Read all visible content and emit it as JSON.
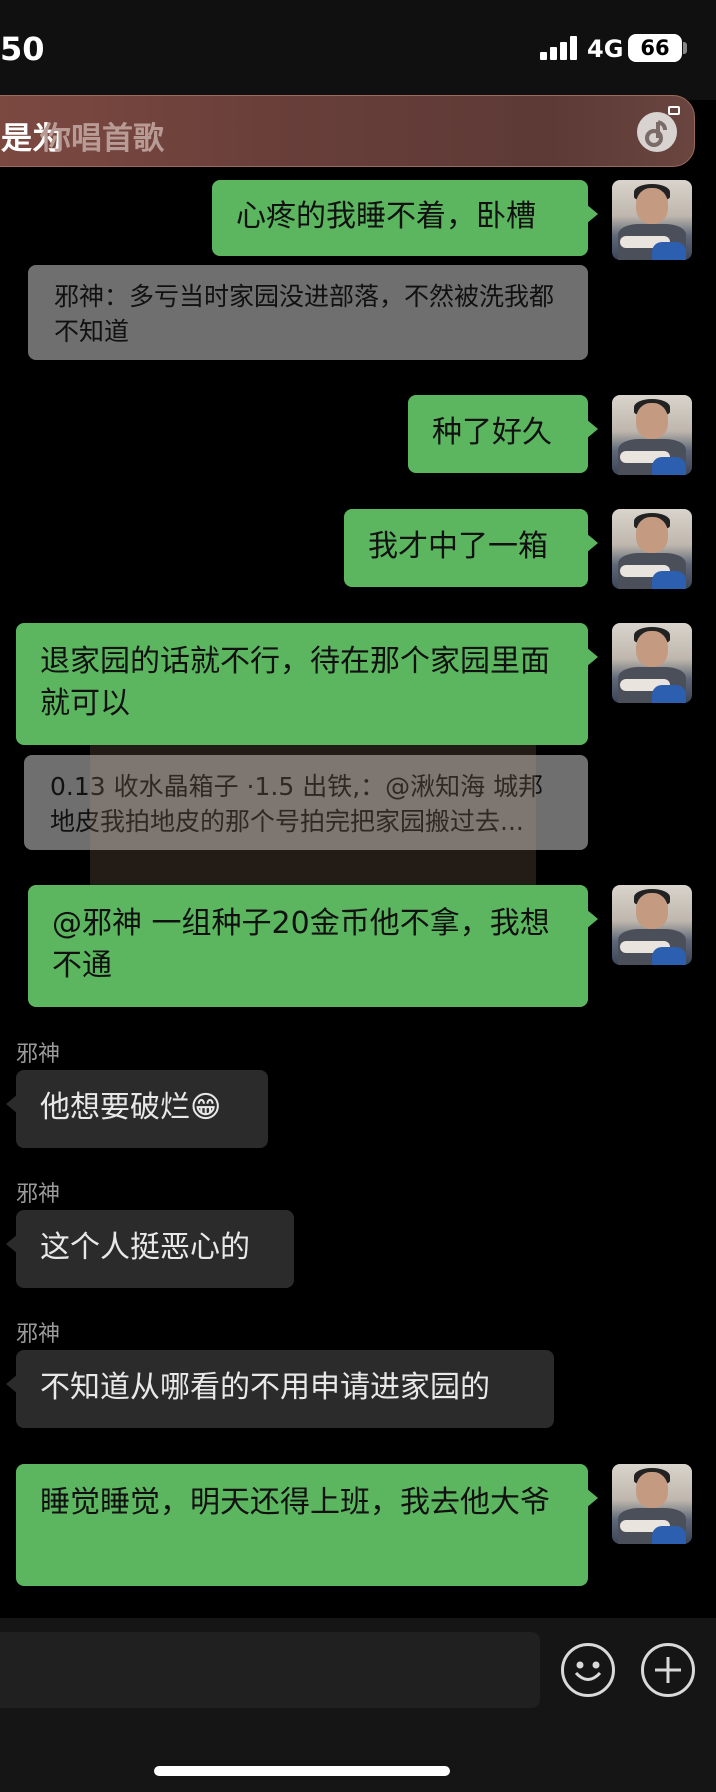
{
  "status_bar": {
    "time": "50",
    "network": "4G",
    "battery": "66"
  },
  "music_banner": {
    "prefix": "是为",
    "text": "你唱首歌",
    "icon": "music-note-icon"
  },
  "messages": [
    {
      "kind": "sent",
      "text": "心疼的我睡不着，卧槽"
    },
    {
      "kind": "quote",
      "text": "邪神：多亏当时家园没进部落，不然被洗我都不知道"
    },
    {
      "kind": "sent",
      "text": "种了好久"
    },
    {
      "kind": "sent",
      "text": "我才中了一箱"
    },
    {
      "kind": "sent",
      "text": "退家园的话就不行，待在那个家园里面就可以"
    },
    {
      "kind": "quote",
      "text": "0.13 收水晶箱子 ·1.5 出铁,：@湫知海 城邦地皮我拍地皮的那个号拍完把家园搬过去..."
    },
    {
      "kind": "sent",
      "text": "@邪神 一组种子20金币他不拿，我想不通"
    },
    {
      "kind": "received",
      "sender": "邪神",
      "text": "他想要破烂😁"
    },
    {
      "kind": "received",
      "sender": "邪神",
      "text": "这个人挺恶心的"
    },
    {
      "kind": "received",
      "sender": "邪神",
      "text": "不知道从哪看的不用申请进家园的"
    },
    {
      "kind": "sent",
      "text": "睡觉睡觉，明天还得上班，我去他大爷"
    }
  ],
  "input_bar": {
    "emoji_icon": "smiley-icon",
    "plus_icon": "plus-circle-icon"
  },
  "colors": {
    "sent_bubble": "#5cb65f",
    "received_bubble": "#2b2b2b",
    "quote_bubble": "#6f6f6f",
    "background": "#000000"
  }
}
